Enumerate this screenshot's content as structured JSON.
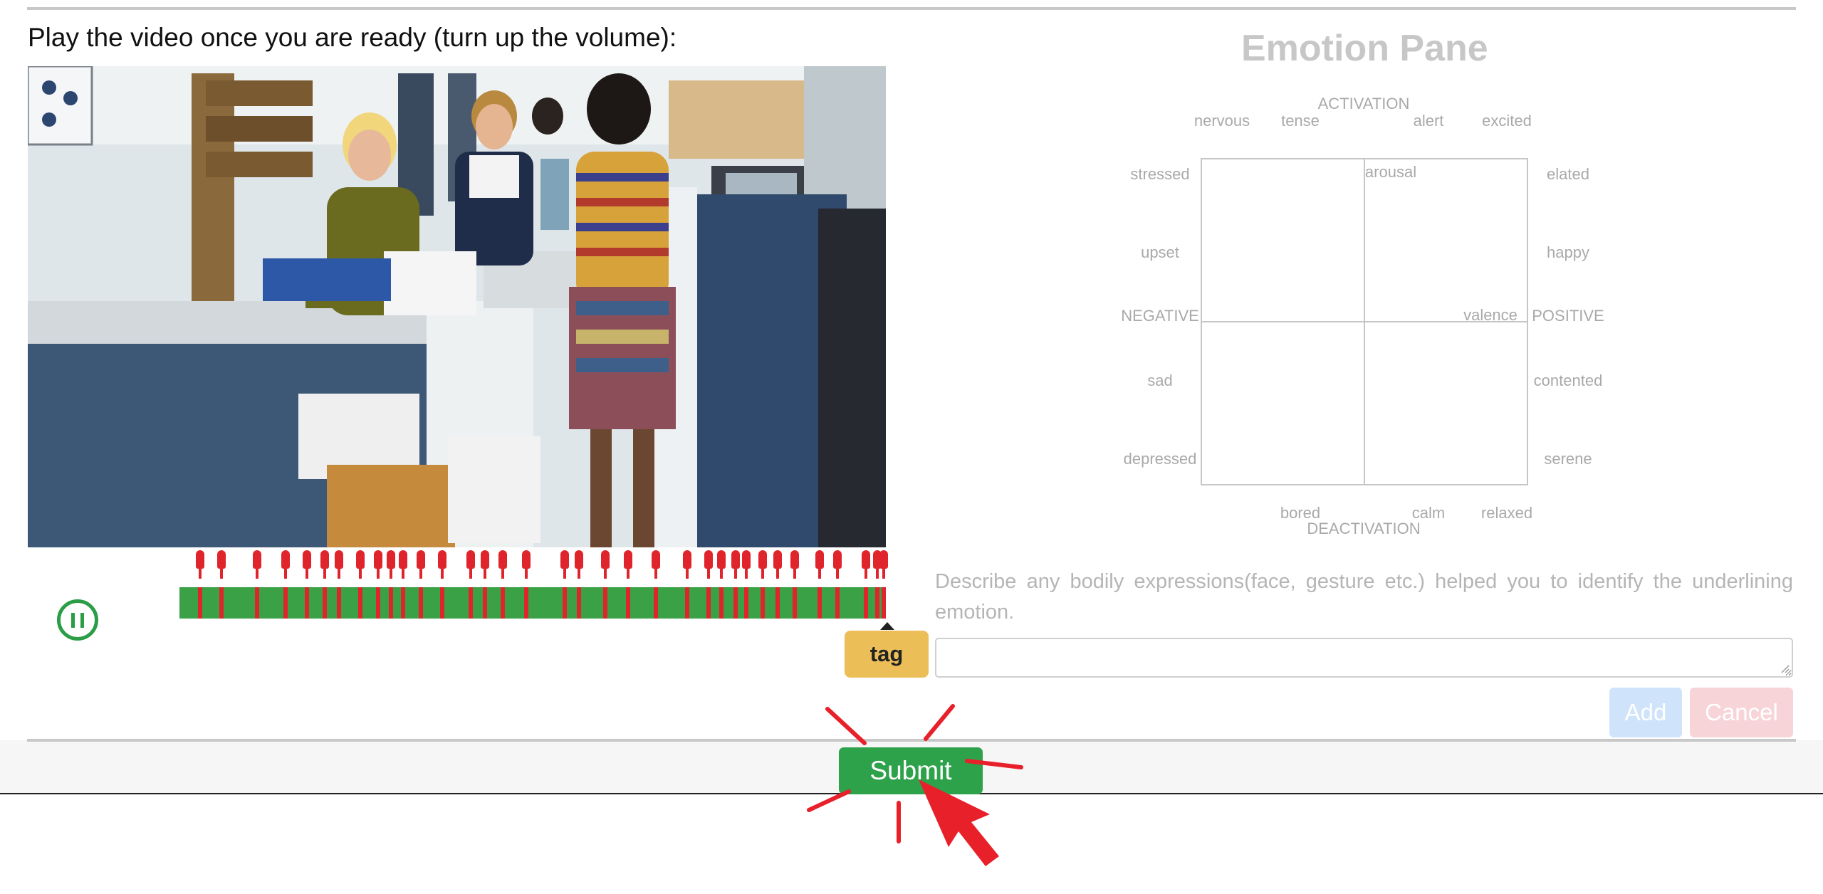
{
  "instruction": "Play the video once you are ready (turn up the volume):",
  "video": {
    "playback_state": "playing",
    "control_icon": "pause-circle-icon",
    "timeline_fill": 1.0,
    "tag_marker_count": 35
  },
  "tag_button": {
    "label": "tag"
  },
  "emotion_pane": {
    "title": "Emotion Pane",
    "axis": {
      "top": "ACTIVATION",
      "bottom": "DEACTIVATION",
      "left": "NEGATIVE",
      "right": "POSITIVE",
      "vertical": "arousal",
      "horizontal": "valence"
    },
    "emotions": {
      "nervous": "nervous",
      "tense": "tense",
      "alert": "alert",
      "excited": "excited",
      "stressed": "stressed",
      "elated": "elated",
      "upset": "upset",
      "happy": "happy",
      "sad": "sad",
      "contented": "contented",
      "depressed": "depressed",
      "serene": "serene",
      "bored": "bored",
      "calm": "calm",
      "relaxed": "relaxed"
    }
  },
  "description": {
    "prompt": "Describe any bodily expressions(face, gesture etc.) helped you to identify the underlining emotion.",
    "value": ""
  },
  "buttons": {
    "add": "Add",
    "cancel": "Cancel",
    "submit": "Submit"
  },
  "colors": {
    "accent_green": "#2ea14b",
    "timeline_green": "#3ba147",
    "marker_red": "#e0242c",
    "tag_yellow": "#ebbe57",
    "add_disabled": "#cfe4fb",
    "cancel_disabled": "#f7d4d8",
    "highlight_red": "#e8202a"
  }
}
